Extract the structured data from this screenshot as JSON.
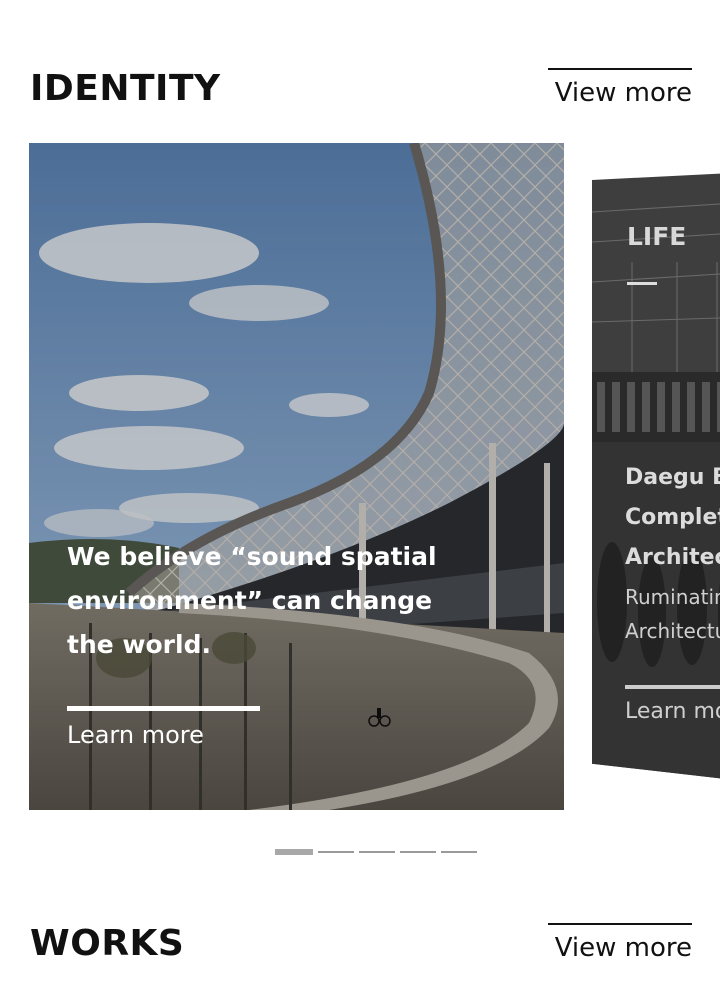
{
  "identity": {
    "title": "IDENTITY",
    "view_more": "View more"
  },
  "main_card": {
    "headline": "We believe “sound spatial environment” can change the world.",
    "learn_more": "Learn more"
  },
  "side_card": {
    "category": "LIFE",
    "title_lines": [
      "Daegu Ba",
      "Complete",
      "Architect"
    ],
    "sub_lines": [
      "Ruminatin",
      "Architectu"
    ],
    "learn_more": "Learn mo"
  },
  "pager": {
    "count": 5,
    "active_index": 0
  },
  "works": {
    "title": "WORKS",
    "view_more": "View more"
  }
}
